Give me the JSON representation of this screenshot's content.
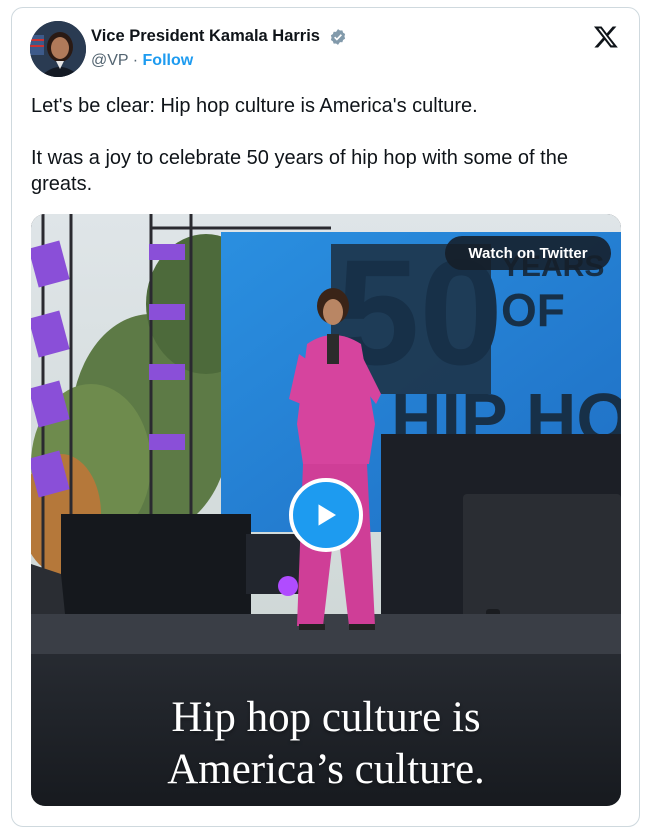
{
  "tweet": {
    "author_name": "Vice President Kamala Harris",
    "handle": "@VP",
    "separator": "·",
    "follow_label": "Follow",
    "paragraphs": [
      "Let's be clear: Hip hop culture is America's culture.",
      "It was a joy to celebrate 50 years of hip hop with some of the greats."
    ]
  },
  "media": {
    "watch_label": "Watch on Twitter",
    "caption_lines": [
      "Hip hop culture is",
      "America’s culture."
    ],
    "banner_number": "50",
    "banner_words": [
      "YEARS",
      "OF",
      "HIP HO"
    ]
  },
  "icons": {
    "verified": "verified-badge-icon",
    "platform": "x-logo-icon",
    "play": "play-icon"
  },
  "colors": {
    "accent": "#1d9bf0",
    "text": "#0f1419",
    "secondary": "#536471",
    "border": "#cfd9de",
    "suit": "#d6449e"
  }
}
